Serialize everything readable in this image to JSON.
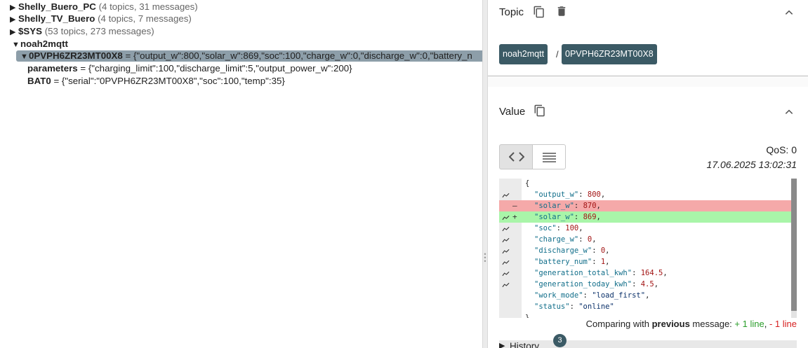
{
  "tree": {
    "nodes": [
      {
        "arrow": "▶",
        "name": "Shelly_Buero_PC",
        "meta": "(4 topics, 31 messages)"
      },
      {
        "arrow": "▶",
        "name": "Shelly_TV_Buero",
        "meta": "(4 topics, 7 messages)"
      },
      {
        "arrow": "▶",
        "name": "$SYS",
        "meta": "(53 topics, 273 messages)"
      },
      {
        "arrow": "▼",
        "name": "noah2mqtt",
        "meta": ""
      }
    ],
    "selected": {
      "arrow": "▼",
      "name": "0PVPH6ZR23MT00X8",
      "value": "= {\"output_w\":800,\"solar_w\":869,\"soc\":100,\"charge_w\":0,\"discharge_w\":0,\"battery_n"
    },
    "children": [
      {
        "name": "parameters",
        "value": "= {\"charging_limit\":100,\"discharge_limit\":5,\"output_power_w\":200}"
      },
      {
        "name": "BAT0",
        "value": "= {\"serial\":\"0PVPH6ZR23MT00X8\",\"soc\":100,\"temp\":35}"
      }
    ]
  },
  "topic": {
    "title": "Topic",
    "breadcrumb": [
      "noah2mqtt",
      "0PVPH6ZR23MT00X8"
    ],
    "separator": "/"
  },
  "value": {
    "title": "Value",
    "qos": "QoS: 0",
    "timestamp": "17.06.2025 13:02:31",
    "diff_lines": [
      {
        "type": "plain",
        "text": "{"
      },
      {
        "type": "plain",
        "chart": true,
        "key": "\"output_w\"",
        "val": "800",
        "comma": ","
      },
      {
        "type": "rem",
        "mark": "–",
        "key": "\"solar_w\"",
        "val": "870",
        "comma": ","
      },
      {
        "type": "add",
        "chart": true,
        "mark": "+",
        "key": "\"solar_w\"",
        "val": "869",
        "comma": ","
      },
      {
        "type": "plain",
        "chart": true,
        "key": "\"soc\"",
        "val": "100",
        "comma": ","
      },
      {
        "type": "plain",
        "chart": true,
        "key": "\"charge_w\"",
        "val": "0",
        "comma": ","
      },
      {
        "type": "plain",
        "chart": true,
        "key": "\"discharge_w\"",
        "val": "0",
        "comma": ","
      },
      {
        "type": "plain",
        "chart": true,
        "key": "\"battery_num\"",
        "val": "1",
        "comma": ","
      },
      {
        "type": "plain",
        "chart": true,
        "key": "\"generation_total_kwh\"",
        "val": "164.5",
        "comma": ","
      },
      {
        "type": "plain",
        "chart": true,
        "key": "\"generation_today_kwh\"",
        "val": "4.5",
        "comma": ","
      },
      {
        "type": "plain",
        "key": "\"work_mode\"",
        "str": "\"load_first\"",
        "comma": ","
      },
      {
        "type": "plain",
        "key": "\"status\"",
        "str": "\"online\"",
        "comma": ""
      },
      {
        "type": "plain",
        "text": "}"
      }
    ],
    "compare": {
      "prefix": "Comparing with",
      "bold": "previous",
      "suffix": "message:",
      "plus": "+ 1 line",
      "sep": ",",
      "minus": "- 1 line"
    }
  },
  "history": {
    "label": "History",
    "count": "3",
    "arrow": "▶"
  },
  "colors": {
    "chip": "#3b5a65",
    "selected": "#8d9ea9",
    "added": "#a9f5a9",
    "removed": "#f5a9a9"
  }
}
